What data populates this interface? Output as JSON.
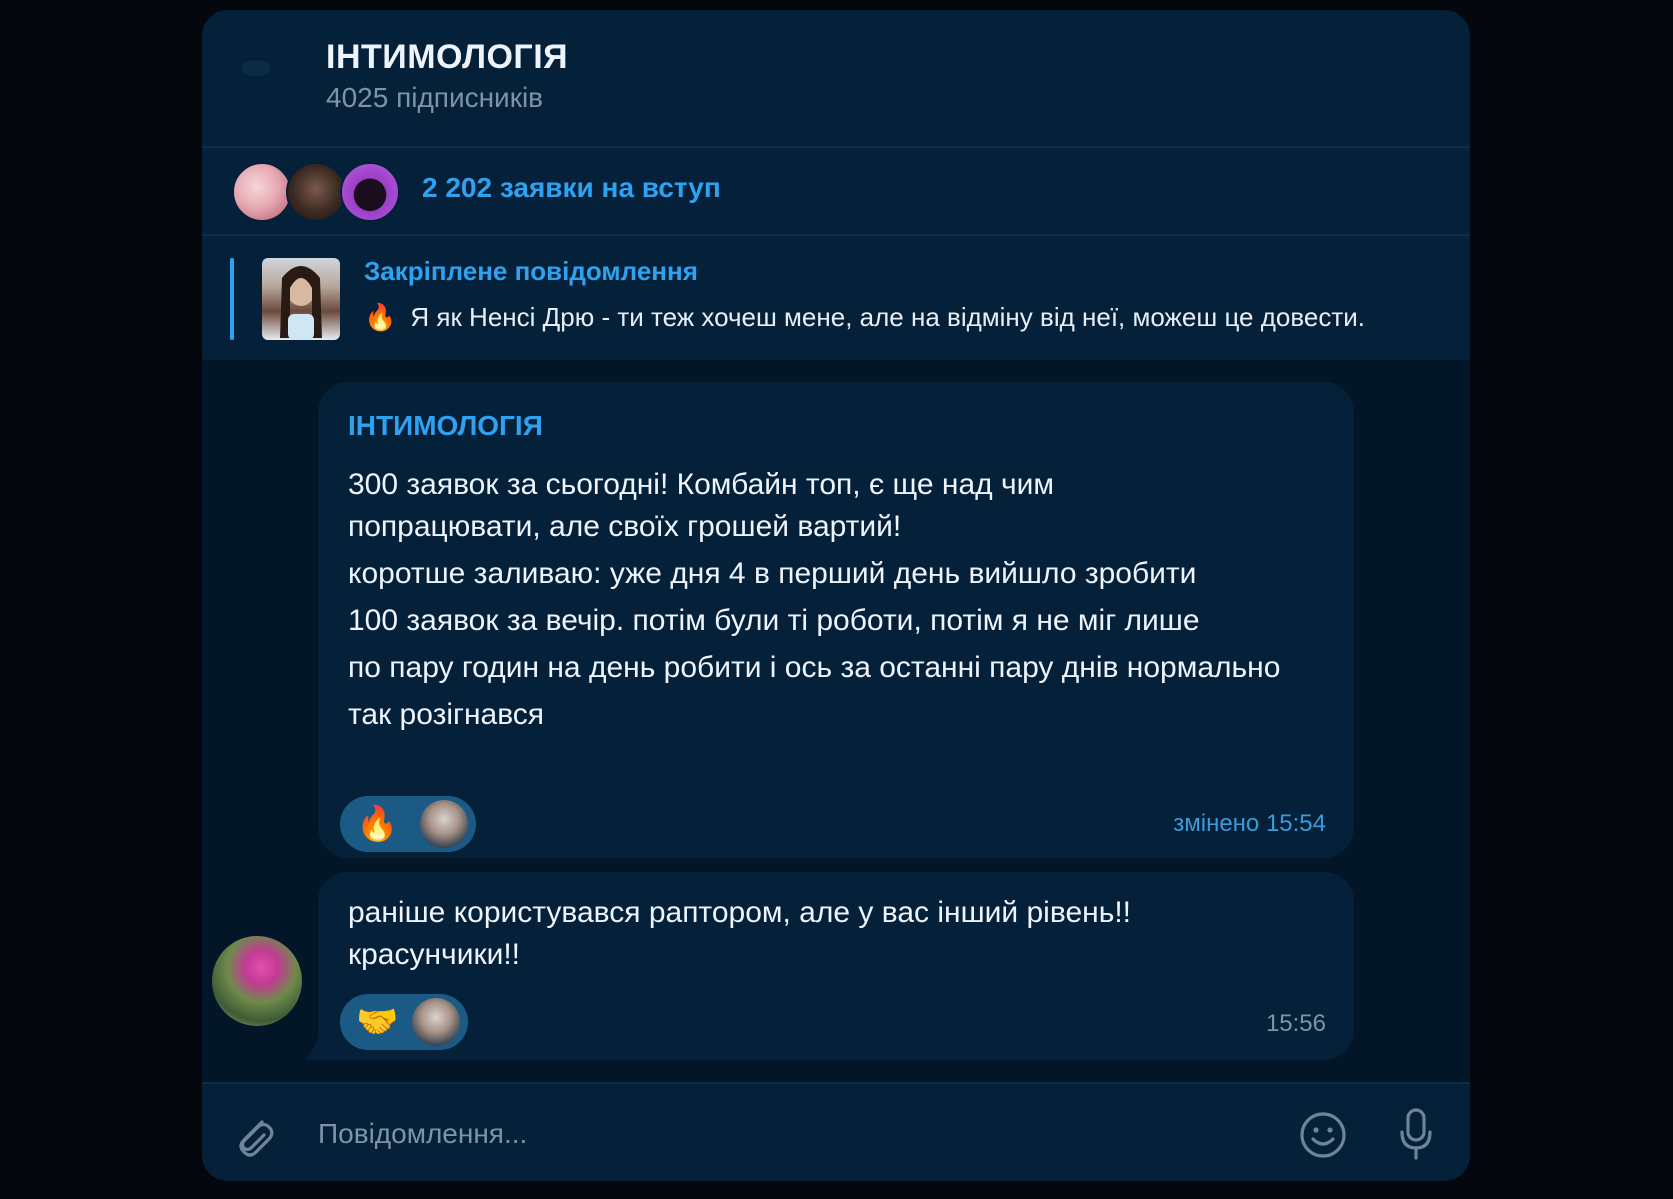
{
  "header": {
    "title": "ІНТИМОЛОГІЯ",
    "subscribers": "4025 підписників"
  },
  "requests": {
    "text": "2 202 заявки на вступ"
  },
  "pinned": {
    "title": "Закріплене повідомлення",
    "emoji": "🔥",
    "text": "Я як Ненсі Дрю - ти теж хочеш мене, але на відміну від неї, можеш це довести."
  },
  "messages": [
    {
      "sender": "ІНТИМОЛОГІЯ",
      "paragraph1": "300 заявок за сьогодні! Комбайн топ, є ще над чим\nпопрацювати, але своїх грошей вартий!",
      "paragraph2": "коротше заливаю: уже дня 4 в перший день вийшло зробити\n100 заявок за вечір. потім були ті роботи, потім я не міг лише\nпо пару годин на день робити і ось за останні пару днів нормально\nтак розігнався",
      "reaction": "🔥",
      "time": "змінено 15:54"
    },
    {
      "text": "раніше користувався раптором, але у вас інший рівень!!\nкрасунчики!!",
      "reaction": "🤝",
      "time": "15:56"
    }
  ],
  "input": {
    "placeholder": "Повідомлення..."
  },
  "colors": {
    "accent": "#2ea2f0",
    "bubble": "#05213a",
    "background": "#021627",
    "reaction": "#1c5a86"
  },
  "icons": [
    "ghost-icon",
    "paperclip-icon",
    "smile-icon",
    "microphone-icon"
  ]
}
